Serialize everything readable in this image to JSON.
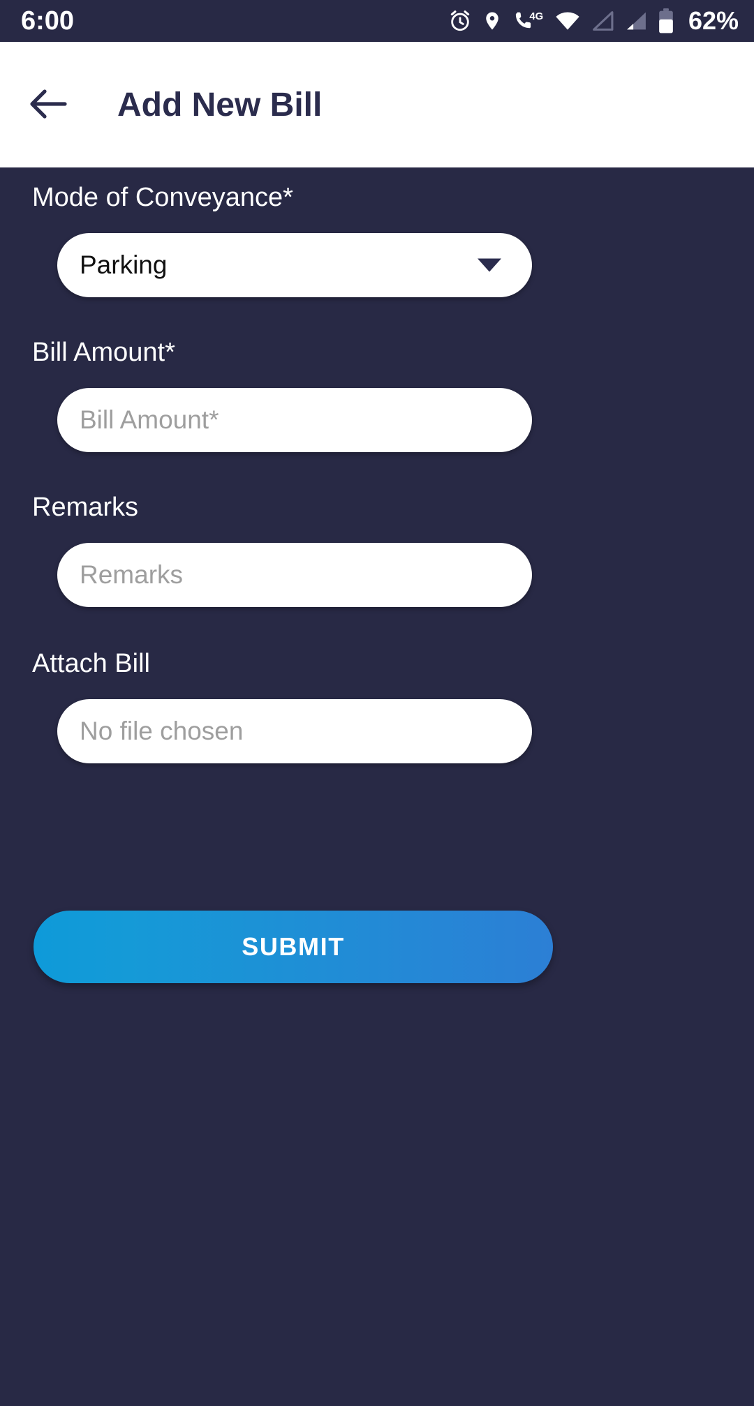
{
  "statusbar": {
    "time": "6:00",
    "battery_percent": "62%",
    "icons": [
      "alarm-icon",
      "location-icon",
      "call-4g-icon",
      "wifi-icon",
      "signal-empty-icon",
      "signal-bars-icon",
      "battery-icon"
    ],
    "network_label": "4G",
    "background_color": "#282945",
    "foreground_color": "#FFFFFF"
  },
  "appbar": {
    "back_icon": "arrow-left-icon",
    "title": "Add New Bill",
    "background_color": "#FFFFFF",
    "text_color": "#2B2C4D"
  },
  "theme": {
    "background_color": "#282945",
    "label_color": "#FFFFFF",
    "field_background": "#FFFFFF",
    "field_text_color": "#111111",
    "placeholder_color": "#9E9E9E",
    "accent_start": "#0E9AD9",
    "accent_end": "#2C7FD5"
  },
  "form": {
    "fields": [
      {
        "label": "Mode of Conveyance*",
        "type": "select",
        "value": "Parking",
        "placeholder": "",
        "caret_icon": "chevron-down-icon",
        "required": true
      },
      {
        "label": "Bill Amount*",
        "type": "text",
        "value": "",
        "placeholder": "Bill Amount*",
        "required": true
      },
      {
        "label": "Remarks",
        "type": "text",
        "value": "",
        "placeholder": "Remarks",
        "required": false
      },
      {
        "label": "Attach Bill",
        "type": "file",
        "value": "",
        "placeholder": "No file chosen",
        "required": false
      }
    ],
    "submit_label": "SUBMIT"
  }
}
